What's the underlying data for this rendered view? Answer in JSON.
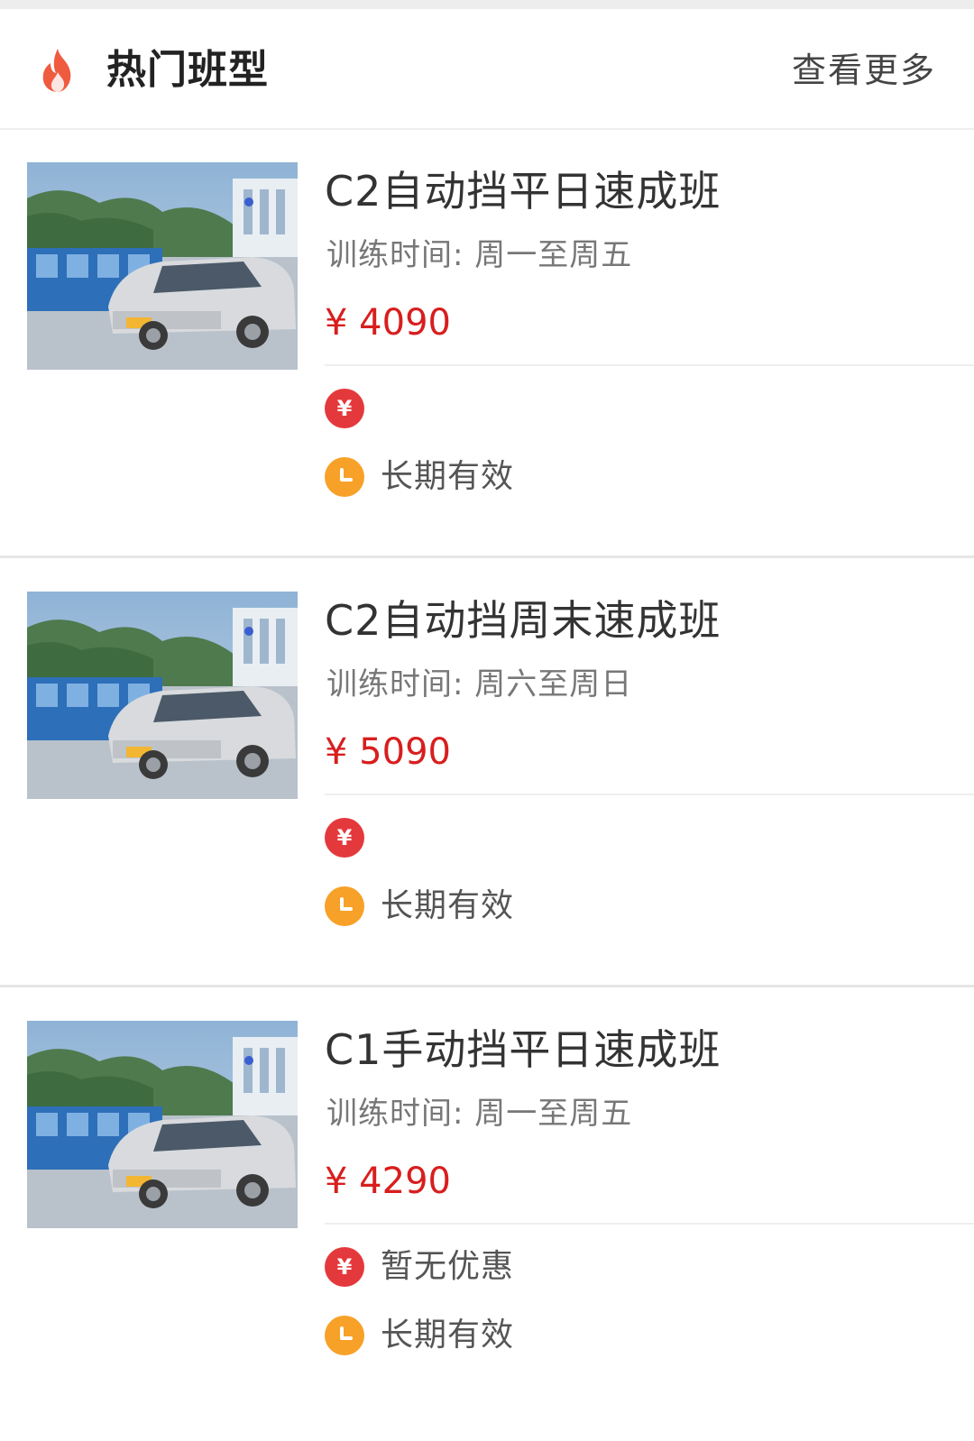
{
  "header": {
    "title": "热门班型",
    "more_label": "查看更多",
    "icon": "flame-icon"
  },
  "colors": {
    "price": "#d81e1e",
    "discount_icon": "#e4393c",
    "validity_icon": "#f7a129",
    "flame": "#ef5b3f"
  },
  "courses": [
    {
      "title": "C2自动挡平日速成班",
      "time": "训练时间: 周一至周五",
      "price": "¥ 4090",
      "discount": "",
      "validity": "长期有效",
      "yen_icon_glyph": "¥"
    },
    {
      "title": "C2自动挡周末速成班",
      "time": "训练时间: 周六至周日",
      "price": "¥ 5090",
      "discount": "",
      "validity": "长期有效",
      "yen_icon_glyph": "¥"
    },
    {
      "title": "C1手动挡平日速成班",
      "time": "训练时间: 周一至周五",
      "price": "¥ 4290",
      "discount": "暂无优惠",
      "validity": "长期有效",
      "yen_icon_glyph": "¥"
    }
  ]
}
